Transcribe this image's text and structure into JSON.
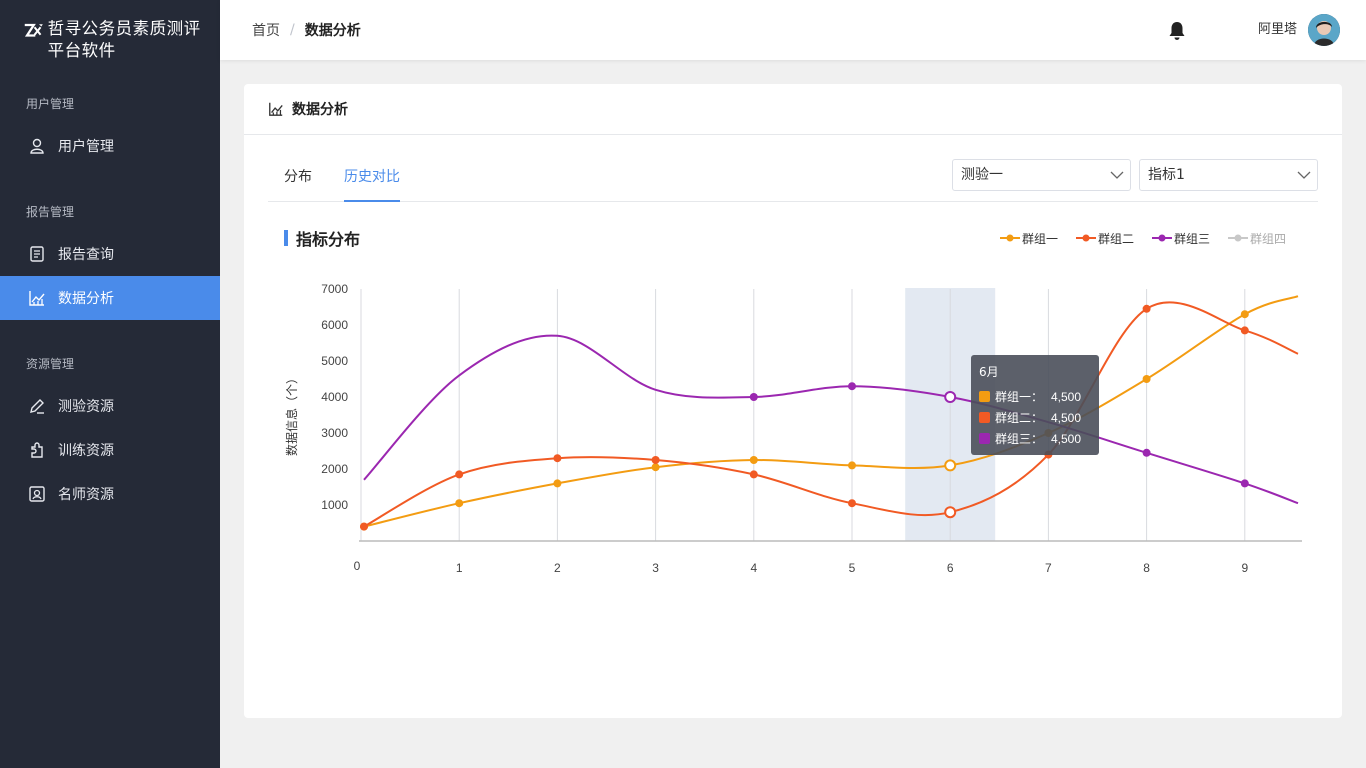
{
  "sidebar": {
    "brand": "哲寻公务员素质测评平台软件",
    "groups": [
      {
        "title": "用户管理",
        "items": [
          {
            "label": "用户管理",
            "icon": "user-icon"
          }
        ]
      },
      {
        "title": "报告管理",
        "items": [
          {
            "label": "报告查询",
            "icon": "report-icon"
          },
          {
            "label": "数据分析",
            "icon": "chart-icon",
            "active": true
          }
        ]
      },
      {
        "title": "资源管理",
        "items": [
          {
            "label": "测验资源",
            "icon": "edit-icon"
          },
          {
            "label": "训练资源",
            "icon": "puzzle-icon"
          },
          {
            "label": "名师资源",
            "icon": "teacher-icon"
          }
        ]
      }
    ]
  },
  "header": {
    "breadcrumb_home": "首页",
    "breadcrumb_sep": "/",
    "breadcrumb_current": "数据分析",
    "username": "阿里塔"
  },
  "card": {
    "title": "数据分析",
    "tabs": [
      "分布",
      "历史对比"
    ],
    "active_tab": "历史对比",
    "select_test": "测验一",
    "select_metric": "指标1",
    "section_title": "指标分布"
  },
  "colors": {
    "accent": "#4a8bea",
    "sidebar": "#252a37",
    "series1": "#f39c12",
    "series2": "#f15a24",
    "series3": "#9b27b0",
    "series4": "#c8c8c8"
  },
  "chart_data": {
    "type": "line",
    "ylabel": "数据信息（个）",
    "xlabel": "",
    "x": [
      0,
      1,
      2,
      3,
      4,
      5,
      6,
      7,
      8,
      9
    ],
    "ylim": [
      0,
      7000
    ],
    "yticks": [
      1000,
      2000,
      3000,
      4000,
      5000,
      6000,
      7000
    ],
    "grid": "vertical",
    "legend_position": "top-right",
    "series": [
      {
        "name": "群组一",
        "values": [
          400,
          1050,
          1600,
          2050,
          2250,
          2100,
          2100,
          3000,
          4500,
          6300
        ],
        "end": 6800
      },
      {
        "name": "群组二",
        "values": [
          400,
          1850,
          2300,
          2250,
          1850,
          1050,
          800,
          2400,
          6450,
          5850
        ],
        "end": 5200
      },
      {
        "name": "群组三",
        "values": [
          1700,
          4600,
          5700,
          4200,
          4000,
          4300,
          4000,
          3300,
          2450,
          1600
        ],
        "end": 1050
      },
      {
        "name": "群组四",
        "values": [],
        "hidden": true
      }
    ],
    "highlight_x": 6,
    "tooltip": {
      "title": "6月",
      "rows": [
        {
          "name": "群组一：",
          "value": "4,500"
        },
        {
          "name": "群组二：",
          "value": "4,500"
        },
        {
          "name": "群组三：",
          "value": "4,500"
        }
      ]
    }
  }
}
